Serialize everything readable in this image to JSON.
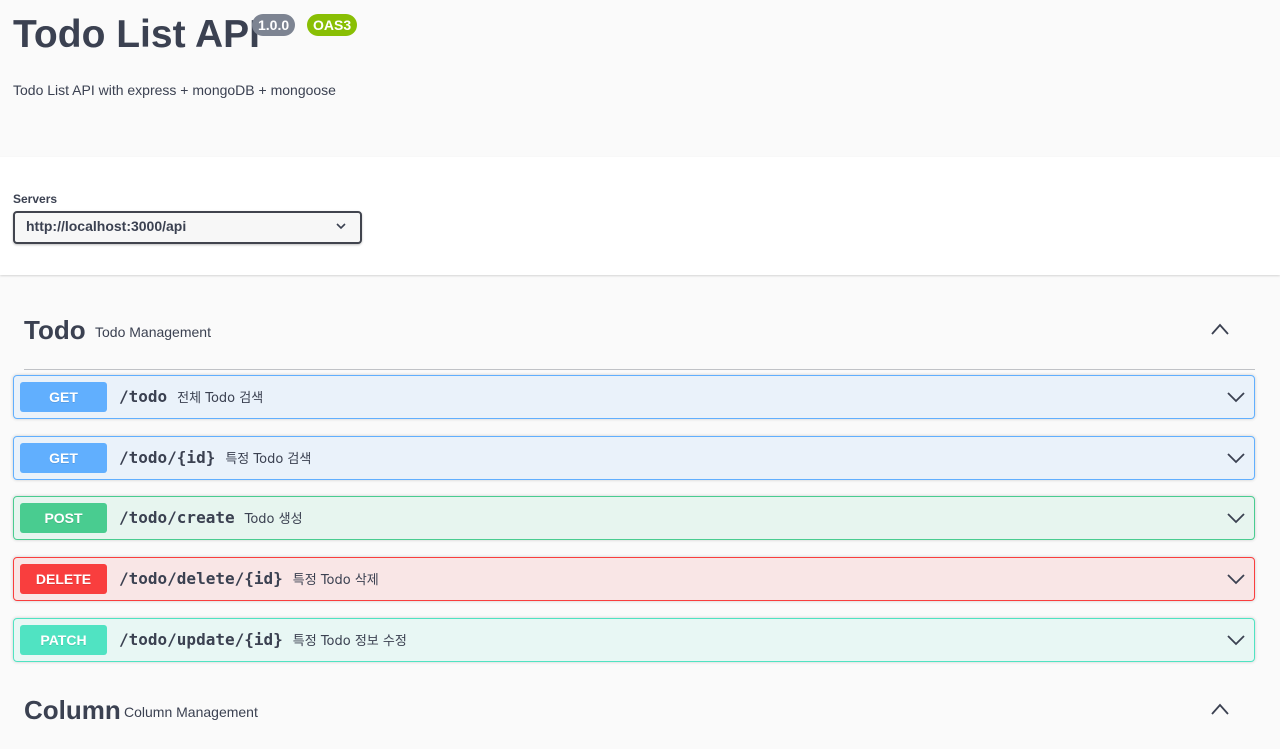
{
  "info": {
    "title": "Todo List API",
    "version": "1.0.0",
    "oas": "OAS3",
    "description": "Todo List API with express + mongoDB + mongoose"
  },
  "servers": {
    "label": "Servers",
    "selected": "http://localhost:3000/api"
  },
  "tags": [
    {
      "name": "Todo",
      "description": "Todo Management",
      "operations": [
        {
          "method": "GET",
          "path": "/todo",
          "summary": "전체 Todo 검색"
        },
        {
          "method": "GET",
          "path": "/todo/{id}",
          "summary": "특정 Todo 검색"
        },
        {
          "method": "POST",
          "path": "/todo/create",
          "summary": "Todo 생성"
        },
        {
          "method": "DELETE",
          "path": "/todo/delete/{id}",
          "summary": "특정 Todo 삭제"
        },
        {
          "method": "PATCH",
          "path": "/todo/update/{id}",
          "summary": "특정 Todo 정보 수정"
        }
      ]
    },
    {
      "name": "Column",
      "description": "Column Management"
    }
  ],
  "colors": {
    "get": "#61affe",
    "post": "#49cc90",
    "delete": "#f93e3e",
    "patch": "#50e3c2",
    "text": "#3b4151"
  }
}
